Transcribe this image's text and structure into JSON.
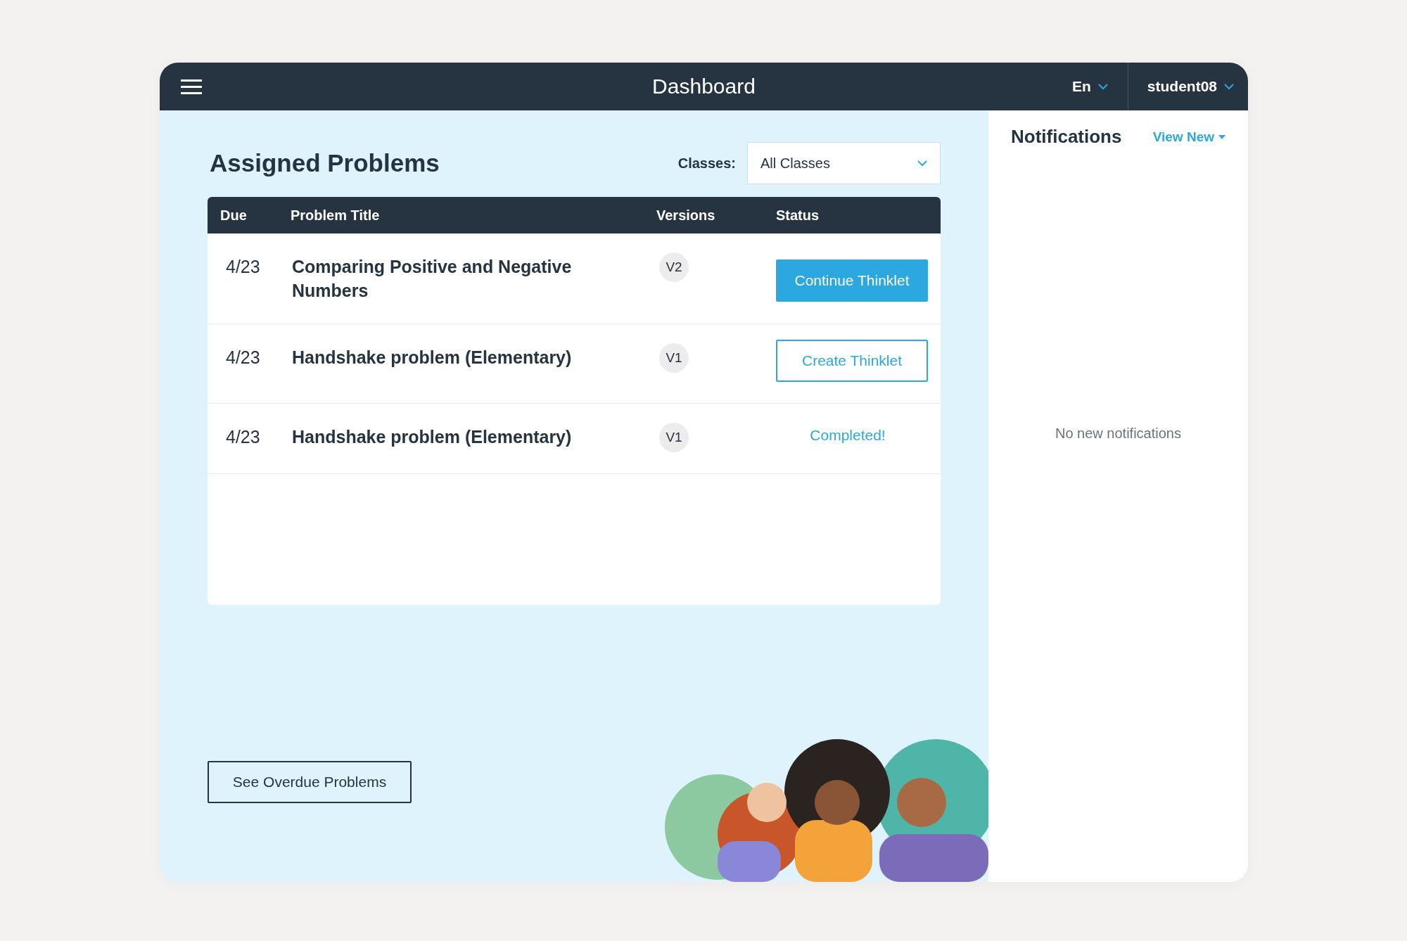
{
  "header": {
    "title": "Dashboard",
    "language": "En",
    "user": "student08"
  },
  "assigned": {
    "title": "Assigned Problems",
    "classes_label": "Classes:",
    "classes_value": "All Classes",
    "columns": [
      "Due",
      "Problem Title",
      "Versions",
      "Status"
    ],
    "rows": [
      {
        "due": "4/23",
        "title": "Comparing Positive and Negative Numbers",
        "version": "V2",
        "status": {
          "kind": "continue",
          "label": "Continue Thinklet"
        }
      },
      {
        "due": "4/23",
        "title": "Handshake problem (Elementary)",
        "version": "V1",
        "status": {
          "kind": "create",
          "label": "Create Thinklet"
        }
      },
      {
        "due": "4/23",
        "title": "Handshake problem (Elementary)",
        "version": "V1",
        "status": {
          "kind": "completed",
          "label": "Completed!"
        }
      }
    ],
    "overdue_button": "See Overdue Problems"
  },
  "notifications": {
    "title": "Notifications",
    "view_new": "View New",
    "empty": "No new notifications"
  }
}
